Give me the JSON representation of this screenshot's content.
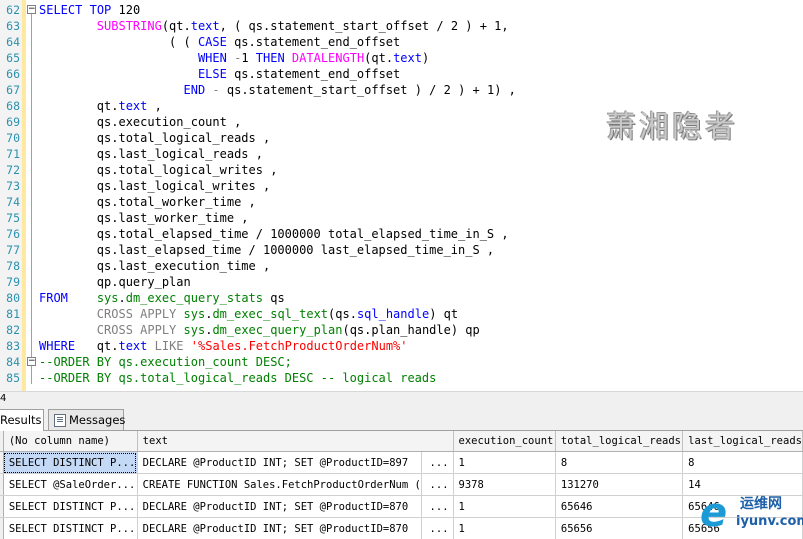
{
  "editor": {
    "lines": [
      {
        "n": "62",
        "tokens": [
          {
            "t": "SELECT",
            "c": "kw"
          },
          {
            "t": " "
          },
          {
            "t": "TOP",
            "c": "kw"
          },
          {
            "t": " 120"
          }
        ]
      },
      {
        "n": "63",
        "tokens": [
          {
            "t": "        "
          },
          {
            "t": "SUBSTRING",
            "c": "fn"
          },
          {
            "t": "(qt."
          },
          {
            "t": "text",
            "c": "kw"
          },
          {
            "t": ", ( qs.statement_start_offset / 2 ) + 1,"
          }
        ]
      },
      {
        "n": "64",
        "tokens": [
          {
            "t": "                  ( ( "
          },
          {
            "t": "CASE",
            "c": "kw"
          },
          {
            "t": " qs.statement_end_offset"
          }
        ]
      },
      {
        "n": "65",
        "tokens": [
          {
            "t": "                      "
          },
          {
            "t": "WHEN",
            "c": "kw"
          },
          {
            "t": " "
          },
          {
            "t": "-",
            "c": "op"
          },
          {
            "t": "1 "
          },
          {
            "t": "THEN",
            "c": "kw"
          },
          {
            "t": " "
          },
          {
            "t": "DATALENGTH",
            "c": "fn"
          },
          {
            "t": "(qt."
          },
          {
            "t": "text",
            "c": "kw"
          },
          {
            "t": ")"
          }
        ]
      },
      {
        "n": "66",
        "tokens": [
          {
            "t": "                      "
          },
          {
            "t": "ELSE",
            "c": "kw"
          },
          {
            "t": " qs.statement_end_offset"
          }
        ]
      },
      {
        "n": "67",
        "tokens": [
          {
            "t": "                    "
          },
          {
            "t": "END",
            "c": "kw"
          },
          {
            "t": " "
          },
          {
            "t": "-",
            "c": "op"
          },
          {
            "t": " qs.statement_start_offset ) / 2 ) + 1) ,"
          }
        ]
      },
      {
        "n": "68",
        "tokens": [
          {
            "t": "        qt."
          },
          {
            "t": "text",
            "c": "kw"
          },
          {
            "t": " ,"
          }
        ]
      },
      {
        "n": "69",
        "tokens": [
          {
            "t": "        qs.execution_count ,"
          }
        ]
      },
      {
        "n": "70",
        "tokens": [
          {
            "t": "        qs.total_logical_reads ,"
          }
        ]
      },
      {
        "n": "71",
        "tokens": [
          {
            "t": "        qs.last_logical_reads ,"
          }
        ]
      },
      {
        "n": "72",
        "tokens": [
          {
            "t": "        qs.total_logical_writes ,"
          }
        ]
      },
      {
        "n": "73",
        "tokens": [
          {
            "t": "        qs.last_logical_writes ,"
          }
        ]
      },
      {
        "n": "74",
        "tokens": [
          {
            "t": "        qs.total_worker_time ,"
          }
        ]
      },
      {
        "n": "75",
        "tokens": [
          {
            "t": "        qs.last_worker_time ,"
          }
        ]
      },
      {
        "n": "76",
        "tokens": [
          {
            "t": "        qs.total_elapsed_time / 1000000 total_elapsed_time_in_S ,"
          }
        ]
      },
      {
        "n": "77",
        "tokens": [
          {
            "t": "        qs.last_elapsed_time / 1000000 last_elapsed_time_in_S ,"
          }
        ]
      },
      {
        "n": "78",
        "tokens": [
          {
            "t": "        qs.last_execution_time ,"
          }
        ]
      },
      {
        "n": "79",
        "tokens": [
          {
            "t": "        qp.query_plan"
          }
        ]
      },
      {
        "n": "80",
        "tokens": [
          {
            "t": "FROM",
            "c": "kw"
          },
          {
            "t": "    "
          },
          {
            "t": "sys",
            "c": "sys"
          },
          {
            "t": "."
          },
          {
            "t": "dm_exec_query_stats",
            "c": "sys"
          },
          {
            "t": " qs"
          }
        ]
      },
      {
        "n": "81",
        "tokens": [
          {
            "t": "        "
          },
          {
            "t": "CROSS APPLY",
            "c": "op"
          },
          {
            "t": " "
          },
          {
            "t": "sys",
            "c": "sys"
          },
          {
            "t": "."
          },
          {
            "t": "dm_exec_sql_text",
            "c": "sys"
          },
          {
            "t": "(qs."
          },
          {
            "t": "sql_handle",
            "c": "kw"
          },
          {
            "t": ") qt"
          }
        ]
      },
      {
        "n": "82",
        "tokens": [
          {
            "t": "        "
          },
          {
            "t": "CROSS APPLY",
            "c": "op"
          },
          {
            "t": " "
          },
          {
            "t": "sys",
            "c": "sys"
          },
          {
            "t": "."
          },
          {
            "t": "dm_exec_query_plan",
            "c": "sys"
          },
          {
            "t": "(qs.plan_handle) qp"
          }
        ]
      },
      {
        "n": "83",
        "tokens": [
          {
            "t": "WHERE",
            "c": "kw"
          },
          {
            "t": "   qt."
          },
          {
            "t": "text",
            "c": "kw"
          },
          {
            "t": " "
          },
          {
            "t": "LIKE",
            "c": "op"
          },
          {
            "t": " "
          },
          {
            "t": "'%Sales.FetchProductOrderNum%'",
            "c": "str"
          }
        ]
      },
      {
        "n": "84",
        "tokens": [
          {
            "t": "--ORDER BY qs.execution_count DESC;",
            "c": "cm"
          }
        ]
      },
      {
        "n": "85",
        "tokens": [
          {
            "t": "--ORDER BY qs.total_logical_reads DESC -- logical reads",
            "c": "cm"
          }
        ]
      }
    ],
    "watermark": "萧湘隐者",
    "zoom_label": "4"
  },
  "tabs": {
    "results": "Results",
    "messages": "Messages"
  },
  "grid": {
    "columns": [
      "(No column name)",
      "text",
      "execution_count",
      "total_logical_reads",
      "last_logical_reads"
    ],
    "rows": [
      [
        "SELECT DISTINCT P...",
        "DECLARE @ProductID INT;  SET @ProductID=897",
        "1",
        "8",
        "8"
      ],
      [
        "SELECT @SaleOrder...",
        "CREATE FUNCTION Sales.FetchProductOrderNum  (",
        "9378",
        "131270",
        "14"
      ],
      [
        "SELECT DISTINCT P...",
        "DECLARE @ProductID INT;  SET @ProductID=870",
        "1",
        "65646",
        "65646"
      ],
      [
        "SELECT DISTINCT P...",
        "DECLARE @ProductID INT;  SET @ProductID=870",
        "1",
        "65656",
        "65656"
      ]
    ],
    "ellipsis": "..."
  },
  "logo": {
    "mark": "e",
    "name": "运维网",
    "domain": "iyunv.com"
  }
}
